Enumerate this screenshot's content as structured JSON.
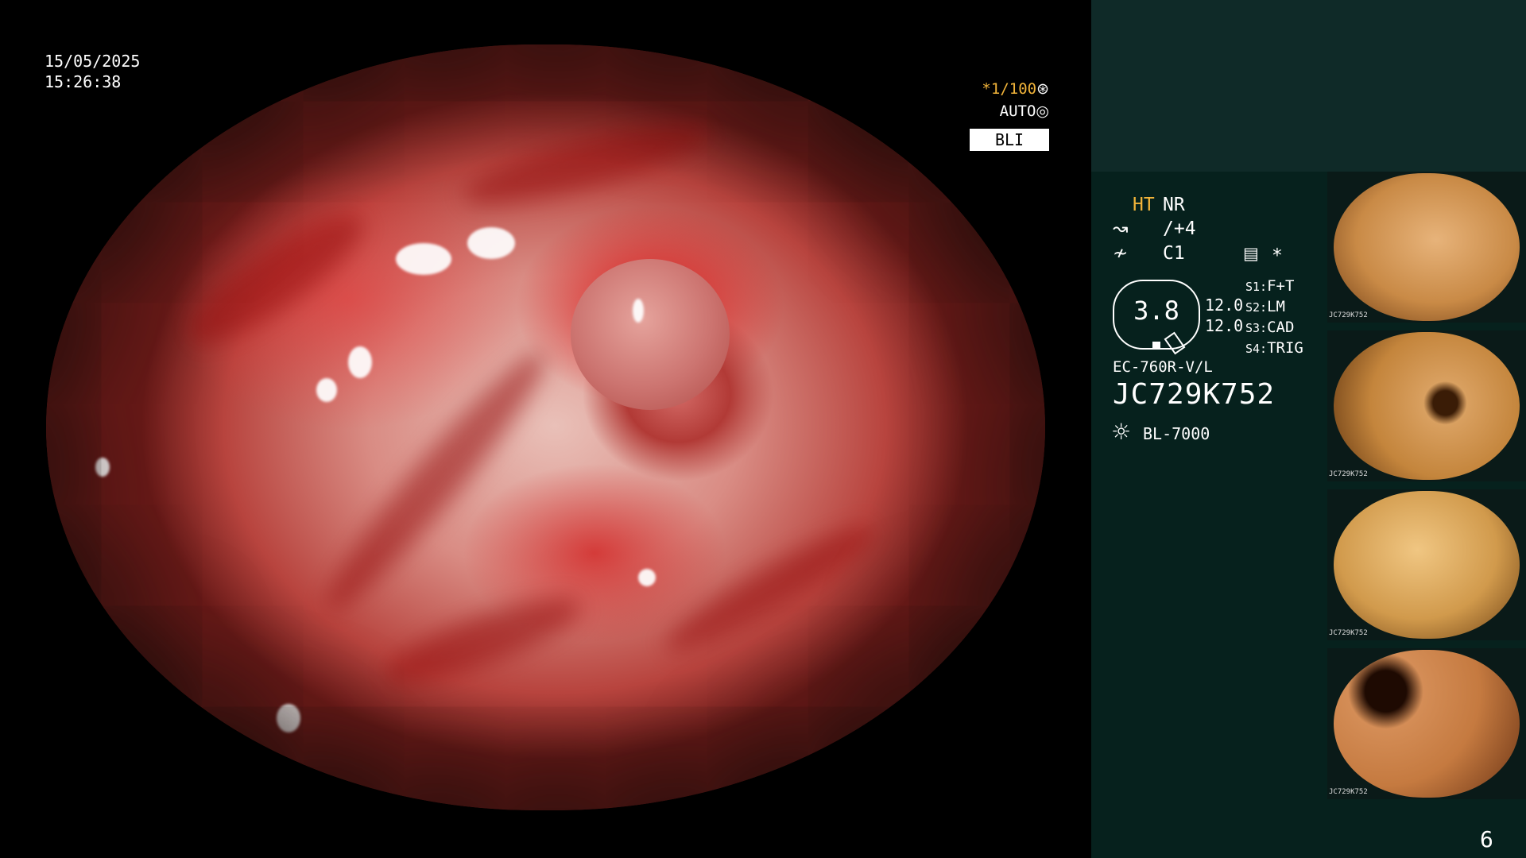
{
  "timestamp": {
    "date": "15/05/2025",
    "time": "15:26:38"
  },
  "top_overlay": {
    "shutter_star": "*",
    "shutter": "1/100",
    "shutter_icon": "⊛",
    "iris": "AUTO",
    "iris_icon": "◎",
    "mode": "BLI"
  },
  "panel": {
    "ht": "HT",
    "nr": "NR",
    "enh_icon": "↝",
    "enh_value": "/+4",
    "color_icon": "≁",
    "color_value": "C1",
    "settings_icon": "▤",
    "settings_star": "*",
    "gauge_value": "3.8",
    "gauge_side_1": "12.0",
    "gauge_side_2": "12.0",
    "switches": [
      {
        "key": "S1:",
        "value": "F+T"
      },
      {
        "key": "S2:",
        "value": "LM"
      },
      {
        "key": "S3:",
        "value": "CAD"
      },
      {
        "key": "S4:",
        "value": "TRIG"
      }
    ],
    "scope_model": "EC-760R-V/L",
    "serial": "JC729K752",
    "light_icon": "☼",
    "light_source": "BL-7000"
  },
  "thumbnails": [
    {
      "label": "JC729K752"
    },
    {
      "label": "JC729K752"
    },
    {
      "label": "JC729K752"
    },
    {
      "label": "JC729K752"
    }
  ],
  "page_number": "6"
}
